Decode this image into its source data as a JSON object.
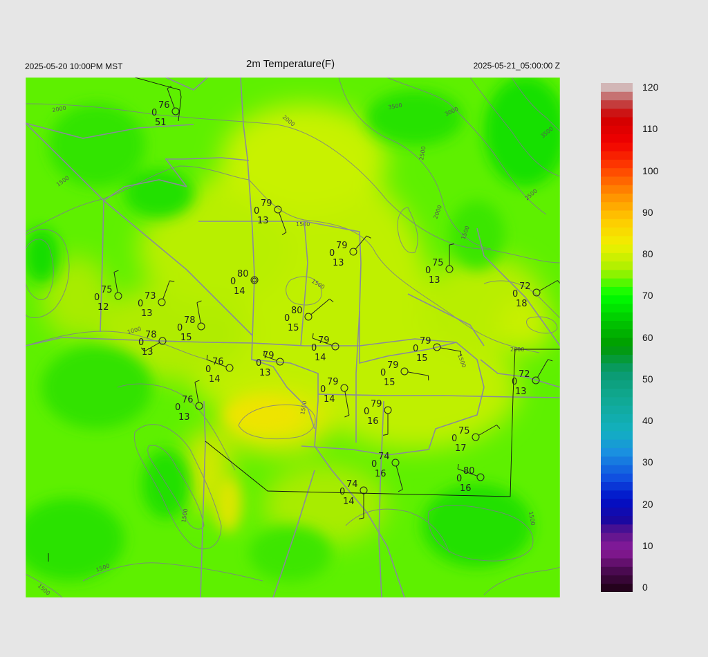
{
  "header": {
    "left_time": "2025-05-20 10:00PM MST",
    "title": "2m Temperature(F)",
    "right_time": "2025-05-21_05:00:00 Z"
  },
  "colorbar": {
    "ticks": [
      "120",
      "110",
      "100",
      "90",
      "80",
      "70",
      "60",
      "50",
      "40",
      "30",
      "20",
      "10",
      "0"
    ],
    "stops": [
      {
        "v": 0,
        "c": "#1a0010"
      },
      {
        "v": 5,
        "c": "#4a0a50"
      },
      {
        "v": 10,
        "c": "#8a1a9a"
      },
      {
        "v": 14,
        "c": "#5a148c"
      },
      {
        "v": 17,
        "c": "#1a08a0"
      },
      {
        "v": 22,
        "c": "#0010c8"
      },
      {
        "v": 27,
        "c": "#1050e0"
      },
      {
        "v": 33,
        "c": "#1a90e0"
      },
      {
        "v": 38,
        "c": "#12b0c0"
      },
      {
        "v": 46,
        "c": "#10a890"
      },
      {
        "v": 52,
        "c": "#0a9a70"
      },
      {
        "v": 58,
        "c": "#009a00"
      },
      {
        "v": 64,
        "c": "#00c800"
      },
      {
        "v": 70,
        "c": "#00ff00"
      },
      {
        "v": 76,
        "c": "#a8f000"
      },
      {
        "v": 82,
        "c": "#f0f000"
      },
      {
        "v": 88,
        "c": "#ffc800"
      },
      {
        "v": 94,
        "c": "#ff8c00"
      },
      {
        "v": 100,
        "c": "#ff4000"
      },
      {
        "v": 106,
        "c": "#f00000"
      },
      {
        "v": 112,
        "c": "#d00000"
      },
      {
        "v": 116,
        "c": "#c05050"
      },
      {
        "v": 120,
        "c": "#d8d8d8"
      }
    ]
  },
  "contours": {
    "labels": [
      "2000",
      "2000",
      "3500",
      "3000",
      "3500",
      "2500",
      "2000",
      "2500",
      "1500",
      "1500",
      "1500",
      "1500",
      "1000",
      "2000",
      "1500",
      "1500",
      "1500",
      "1500",
      "1500",
      "1500"
    ]
  },
  "stations": [
    {
      "temp": "76",
      "p": "0",
      "dew": "51"
    },
    {
      "temp": "79",
      "p": "0",
      "dew": "13"
    },
    {
      "temp": "79",
      "p": "0",
      "dew": "13"
    },
    {
      "temp": "75",
      "p": "0",
      "dew": "13"
    },
    {
      "temp": "80",
      "p": "0",
      "dew": "14"
    },
    {
      "temp": "75",
      "p": "0",
      "dew": "12"
    },
    {
      "temp": "73",
      "p": "0",
      "dew": "13"
    },
    {
      "temp": "72",
      "p": "0",
      "dew": "18"
    },
    {
      "temp": "78",
      "p": "0",
      "dew": "15"
    },
    {
      "temp": "80",
      "p": "0",
      "dew": "15"
    },
    {
      "temp": "78",
      "p": "0",
      "dew": "13"
    },
    {
      "temp": "79",
      "p": "0",
      "dew": "14"
    },
    {
      "temp": "79",
      "p": "0",
      "dew": "15"
    },
    {
      "temp": "76",
      "p": "0",
      "dew": "14"
    },
    {
      "temp": "79",
      "p": "0",
      "dew": "13"
    },
    {
      "temp": "79",
      "p": "0",
      "dew": "15"
    },
    {
      "temp": "72",
      "p": "0",
      "dew": "13"
    },
    {
      "temp": "79",
      "p": "0",
      "dew": "14"
    },
    {
      "temp": "76",
      "p": "0",
      "dew": "13"
    },
    {
      "temp": "79",
      "p": "0",
      "dew": "16"
    },
    {
      "temp": "75",
      "p": "0",
      "dew": "17"
    },
    {
      "temp": "74",
      "p": "0",
      "dew": "16"
    },
    {
      "temp": "80",
      "p": "0",
      "dew": "16"
    },
    {
      "temp": "74",
      "p": "0",
      "dew": "14"
    }
  ]
}
